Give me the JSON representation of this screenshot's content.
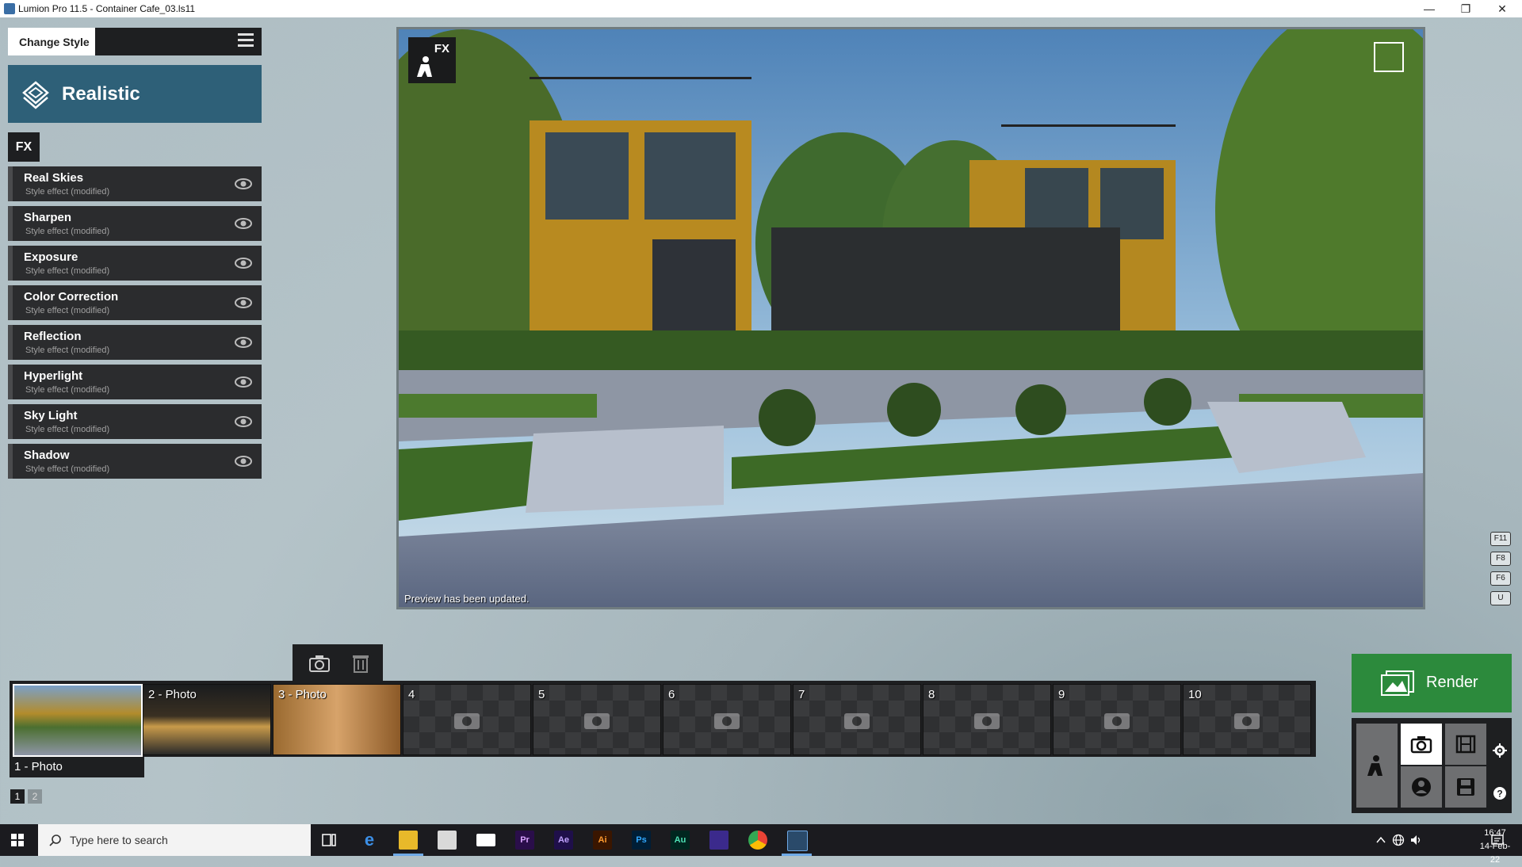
{
  "window": {
    "title": "Lumion Pro 11.5  - Container Cafe_03.ls11",
    "minimize": "—",
    "restore": "❐",
    "close": "✕"
  },
  "left_panel": {
    "change_style_label": "Change Style",
    "style_name": "Realistic",
    "fx_tag": "FX",
    "effects": [
      {
        "name": "Real Skies",
        "sub": "Style effect (modified)"
      },
      {
        "name": "Sharpen",
        "sub": "Style effect (modified)"
      },
      {
        "name": "Exposure",
        "sub": "Style effect (modified)"
      },
      {
        "name": "Color Correction",
        "sub": "Style effect (modified)"
      },
      {
        "name": "Reflection",
        "sub": "Style effect (modified)"
      },
      {
        "name": "Hyperlight",
        "sub": "Style effect (modified)"
      },
      {
        "name": "Sky Light",
        "sub": "Style effect (modified)"
      },
      {
        "name": "Shadow",
        "sub": "Style effect (modified)"
      }
    ]
  },
  "viewport": {
    "fx_badge": "FX",
    "status": "Preview has been updated."
  },
  "key_hints": [
    "F11",
    "F8",
    "F6",
    "U"
  ],
  "thumbnails": {
    "slots": [
      {
        "label": ""
      },
      {
        "label": "2 - Photo"
      },
      {
        "label": "3 - Photo"
      },
      {
        "label": "4"
      },
      {
        "label": "5"
      },
      {
        "label": "6"
      },
      {
        "label": "7"
      },
      {
        "label": "8"
      },
      {
        "label": "9"
      },
      {
        "label": "10"
      }
    ],
    "active_caption": "1 - Photo",
    "pages": [
      "1",
      "2"
    ]
  },
  "render": {
    "label": "Render"
  },
  "taskbar": {
    "search_placeholder": "Type here to search",
    "apps": [
      {
        "name": "Pr",
        "color": "#2a0e4a",
        "fg": "#d9a3ff"
      },
      {
        "name": "Ae",
        "color": "#1f0f4a",
        "fg": "#c2a3ff"
      },
      {
        "name": "Ai",
        "color": "#3a1600",
        "fg": "#ff9a2e"
      },
      {
        "name": "Ps",
        "color": "#001e36",
        "fg": "#31a8ff"
      },
      {
        "name": "Au",
        "color": "#00261f",
        "fg": "#4fe3b6"
      }
    ],
    "time": "16:47",
    "date": "14-Feb-22"
  },
  "colors": {
    "style_header": "#2e6078",
    "render_green": "#2c8a3c",
    "panel_dark": "#1e1f21"
  }
}
